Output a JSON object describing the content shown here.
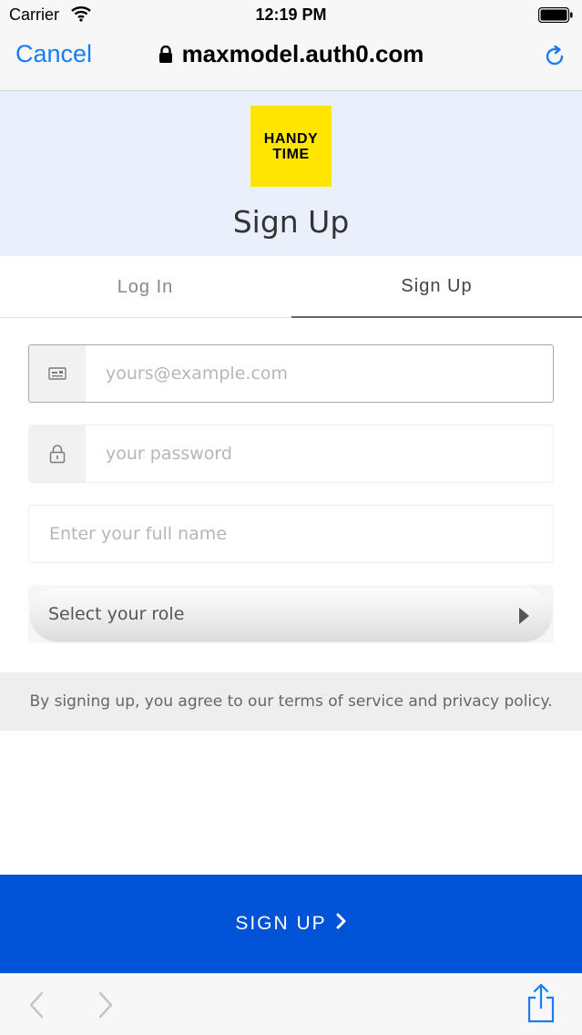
{
  "status_bar": {
    "carrier": "Carrier",
    "time": "12:19 PM"
  },
  "browser": {
    "cancel_label": "Cancel",
    "url": "maxmodel.auth0.com",
    "accent_color": "#1a7cf2"
  },
  "header": {
    "logo_line1": "HANDY",
    "logo_line2": "TIME",
    "logo_color": "#ffe600",
    "title": "Sign Up"
  },
  "tabs": [
    {
      "label": "Log In",
      "active": false
    },
    {
      "label": "Sign Up",
      "active": true
    }
  ],
  "form": {
    "email": {
      "value": "",
      "placeholder": "yours@example.com",
      "icon": "email-icon"
    },
    "password": {
      "value": "",
      "placeholder": "your password",
      "icon": "lock-icon"
    },
    "full_name": {
      "value": "",
      "placeholder": "Enter your full name"
    },
    "role": {
      "selected": "Select your role"
    }
  },
  "terms_text": "By signing up, you agree to our terms of service and privacy policy.",
  "submit": {
    "label": "SIGN UP",
    "color": "#0053d6"
  }
}
